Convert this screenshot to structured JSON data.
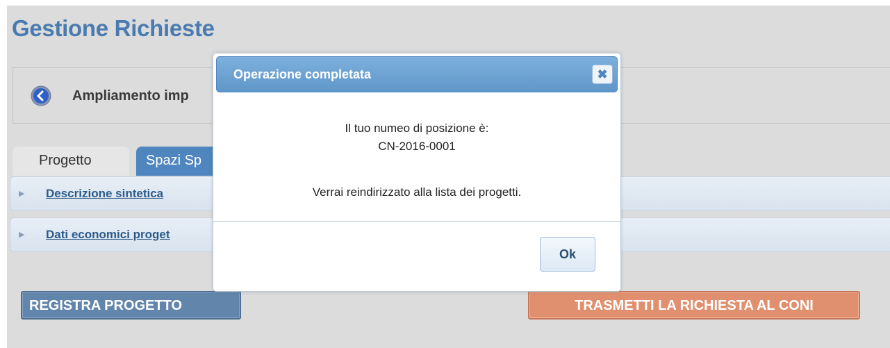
{
  "page": {
    "title": "Gestione Richieste",
    "project_name": "Ampliamento imp",
    "back_icon": "back-arrow-circle-icon"
  },
  "tabs": [
    {
      "label": "Progetto",
      "active": false
    },
    {
      "label": "Spazi Sp",
      "active": true
    }
  ],
  "sections": [
    {
      "label": "Descrizione sintetica"
    },
    {
      "label": "Dati economici proget"
    }
  ],
  "actions": {
    "registra_label": "REGISTRA PROGETTO",
    "trasmetti_label": "TRASMETTI LA RICHIESTA AL CONI"
  },
  "dialog": {
    "title": "Operazione completata",
    "close_icon": "close-x-icon",
    "line1": "Il tuo numeo di posizione è:",
    "line2": "CN-2016-0001",
    "line3": "Verrai reindirizzato alla lista dei progetti.",
    "ok_label": "Ok"
  },
  "colors": {
    "title": "#4a7bb0",
    "active_tab": "#4f86bf",
    "registra_button": "#6285ab",
    "trasmetti_button": "#e0906e",
    "dialog_header": "#6aa0d2"
  }
}
